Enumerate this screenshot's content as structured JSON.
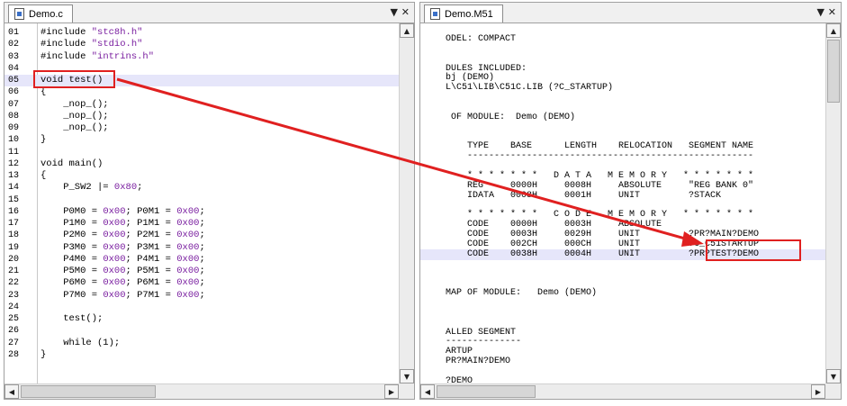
{
  "left": {
    "tab_label": "Demo.c",
    "lines": [
      {
        "n": "01",
        "t": "#include \"stc8h.h\""
      },
      {
        "n": "02",
        "t": "#include \"stdio.h\""
      },
      {
        "n": "03",
        "t": "#include \"intrins.h\""
      },
      {
        "n": "04",
        "t": ""
      },
      {
        "n": "05",
        "t": "void test()"
      },
      {
        "n": "06",
        "t": "{"
      },
      {
        "n": "07",
        "t": "    _nop_();"
      },
      {
        "n": "08",
        "t": "    _nop_();"
      },
      {
        "n": "09",
        "t": "    _nop_();"
      },
      {
        "n": "10",
        "t": "}"
      },
      {
        "n": "11",
        "t": ""
      },
      {
        "n": "12",
        "t": "void main()"
      },
      {
        "n": "13",
        "t": "{"
      },
      {
        "n": "14",
        "t": "    P_SW2 |= 0x80;"
      },
      {
        "n": "15",
        "t": ""
      },
      {
        "n": "16",
        "t": "    P0M0 = 0x00; P0M1 = 0x00;"
      },
      {
        "n": "17",
        "t": "    P1M0 = 0x00; P1M1 = 0x00;"
      },
      {
        "n": "18",
        "t": "    P2M0 = 0x00; P2M1 = 0x00;"
      },
      {
        "n": "19",
        "t": "    P3M0 = 0x00; P3M1 = 0x00;"
      },
      {
        "n": "20",
        "t": "    P4M0 = 0x00; P4M1 = 0x00;"
      },
      {
        "n": "21",
        "t": "    P5M0 = 0x00; P5M1 = 0x00;"
      },
      {
        "n": "22",
        "t": "    P6M0 = 0x00; P6M1 = 0x00;"
      },
      {
        "n": "23",
        "t": "    P7M0 = 0x00; P7M1 = 0x00;"
      },
      {
        "n": "24",
        "t": ""
      },
      {
        "n": "25",
        "t": "    test();"
      },
      {
        "n": "26",
        "t": ""
      },
      {
        "n": "27",
        "t": "    while (1);"
      },
      {
        "n": "28",
        "t": "}"
      }
    ]
  },
  "right": {
    "tab_label": "Demo.M51",
    "lines": [
      "ODEL: COMPACT",
      "",
      "",
      "DULES INCLUDED:",
      "bj (DEMO)",
      "L\\C51\\LIB\\C51C.LIB (?C_STARTUP)",
      "",
      "",
      " OF MODULE:  Demo (DEMO)",
      "",
      "",
      "    TYPE    BASE      LENGTH    RELOCATION   SEGMENT NAME",
      "    -----------------------------------------------------",
      "",
      "    * * * * * * *   D A T A   M E M O R Y   * * * * * * *",
      "    REG     0000H     0008H     ABSOLUTE     \"REG BANK 0\"",
      "    IDATA   0008H     0001H     UNIT         ?STACK",
      "",
      "    * * * * * * *   C O D E   M E M O R Y   * * * * * * *",
      "    CODE    0000H     0003H     ABSOLUTE",
      "    CODE    0003H     0029H     UNIT         ?PR?MAIN?DEMO",
      "    CODE    002CH     000CH     UNIT         ?C_C51STARTUP",
      "    CODE    0038H     0004H     UNIT         ?PR?TEST?DEMO",
      "",
      "",
      "",
      "MAP OF MODULE:   Demo (DEMO)",
      "",
      "",
      "",
      "ALLED SEGMENT",
      "--------------",
      "ARTUP",
      "PR?MAIN?DEMO",
      "",
      "?DEMO"
    ]
  },
  "colors": {
    "annotation": "#e02020",
    "highlight": "#e6e6fa",
    "hex_literal": "#7a1fa0",
    "string": "#7a1fa0"
  },
  "icons": {
    "close": "close-icon",
    "dropdown": "dropdown-arrow-icon"
  }
}
